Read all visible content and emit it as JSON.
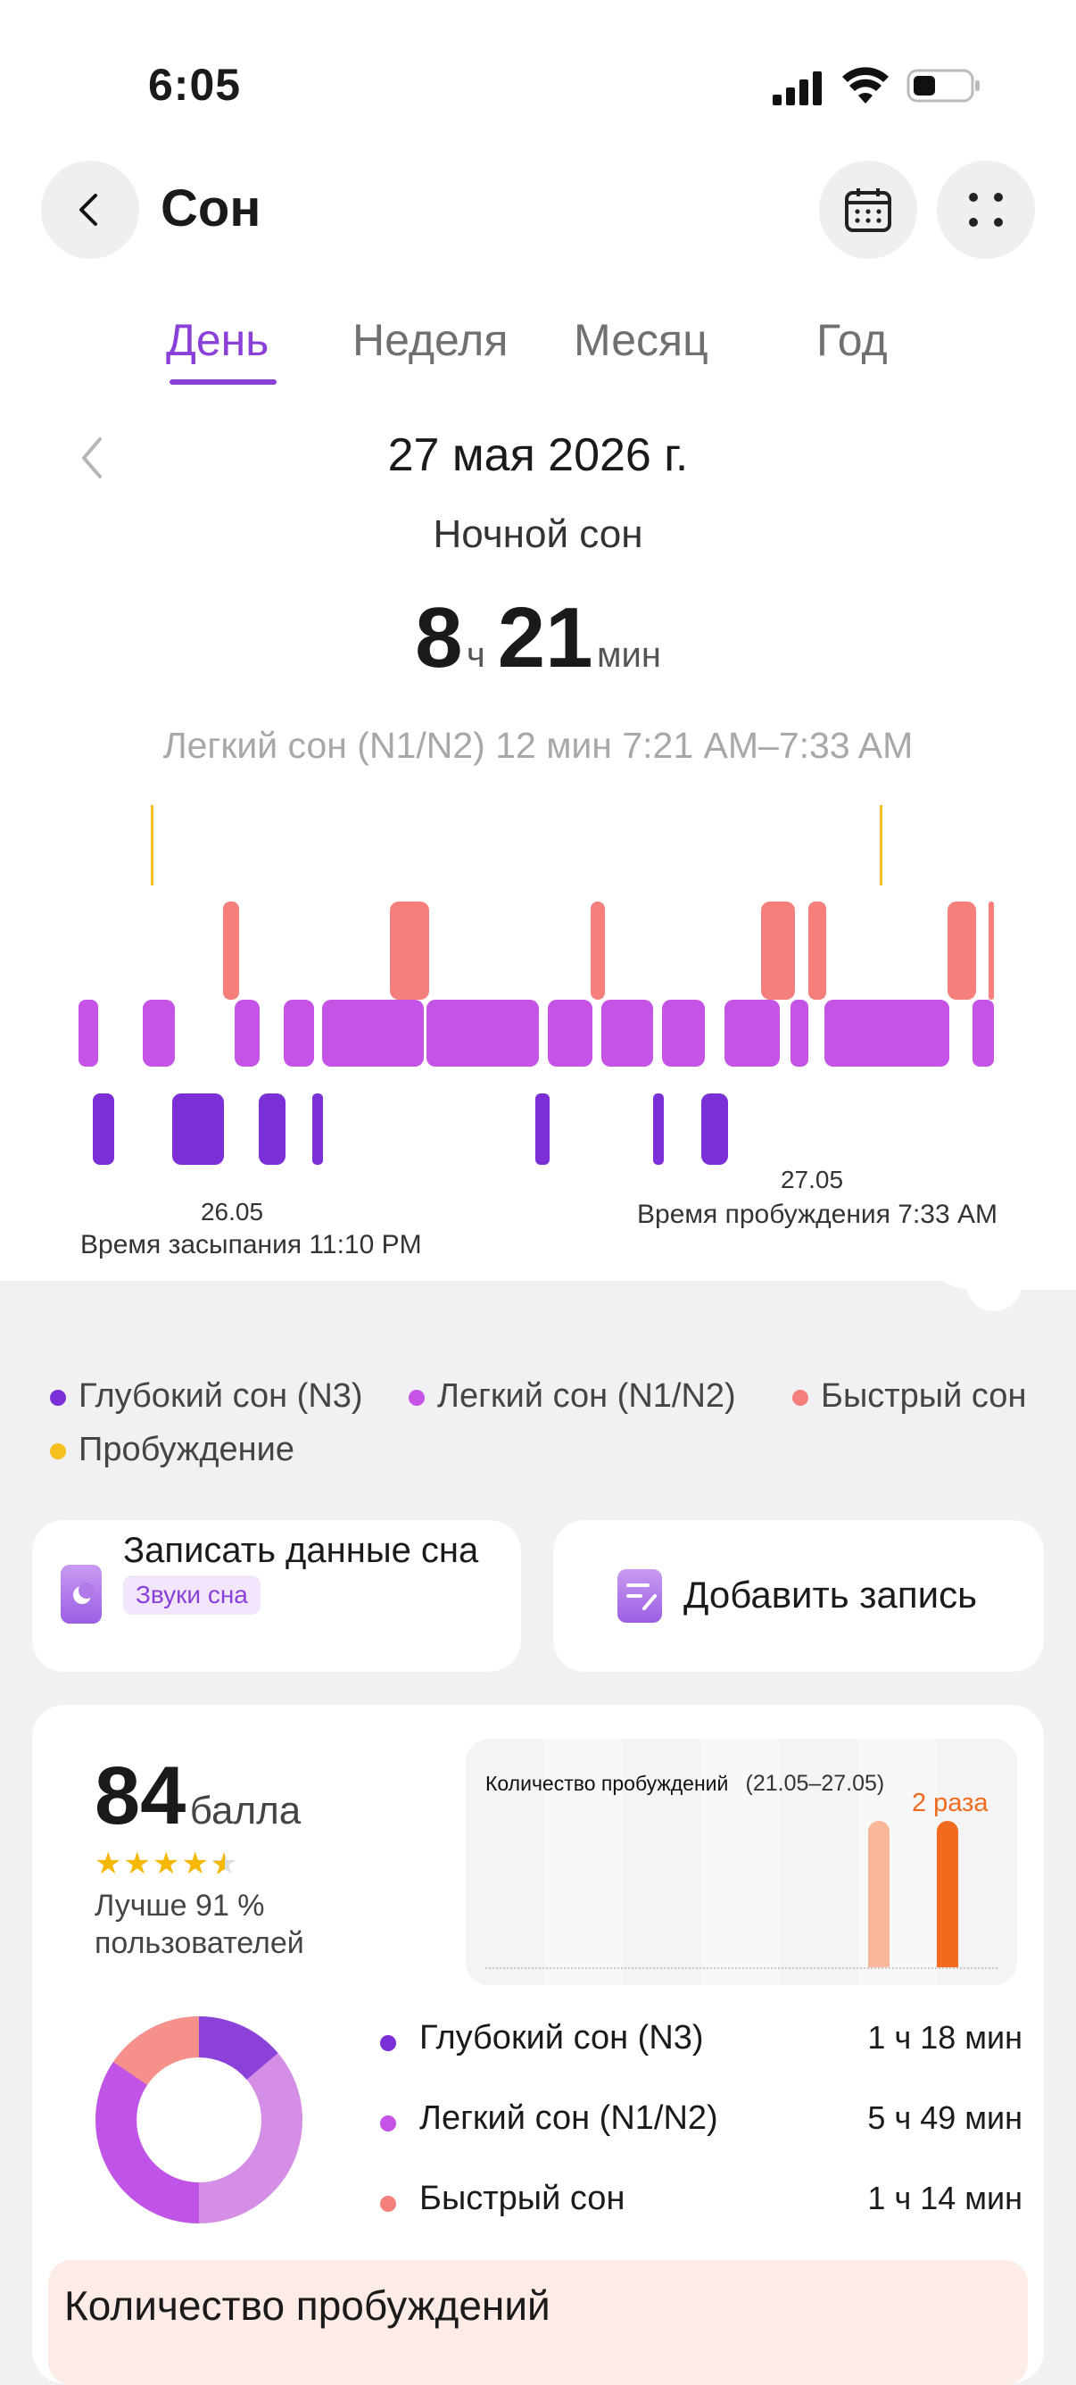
{
  "status_bar": {
    "time": "6:05"
  },
  "header": {
    "title": "Сон"
  },
  "tabs": [
    {
      "label": "День",
      "active": true
    },
    {
      "label": "Неделя",
      "active": false
    },
    {
      "label": "Месяц",
      "active": false
    },
    {
      "label": "Год",
      "active": false
    }
  ],
  "summary": {
    "date": "27 мая 2026 г.",
    "sleep_type": "Ночной сон",
    "hours": "8",
    "hours_unit": "ч",
    "minutes": "21",
    "minutes_unit": "мин",
    "selected_segment": "Легкий сон (N1/N2) 12 мин 7:21 AM–7:33 AM"
  },
  "hypnogram": {
    "start_date": "26.05",
    "start_label": "Время засыпания 11:10 PM",
    "end_date": "27.05",
    "end_label": "Время пробуждения 7:33 AM"
  },
  "legend": [
    {
      "label": "Глубокий сон (N3)",
      "color": "#7b2fd6"
    },
    {
      "label": "Легкий сон (N1/N2)",
      "color": "#c554e6"
    },
    {
      "label": "Быстрый сон",
      "color": "#f57f7a"
    },
    {
      "label": "Пробуждение",
      "color": "#f5c020"
    }
  ],
  "actions": {
    "record": {
      "title": "Записать данные сна",
      "chip": "Звуки сна"
    },
    "add": {
      "title": "Добавить запись"
    }
  },
  "score": {
    "value": "84",
    "unit": "балла",
    "stars": 4.5,
    "better_than": "Лучше 91 %",
    "better_than_suffix": "пользователей"
  },
  "wake_chart": {
    "title": "Количество пробуждений",
    "range": "(21.05–27.05)",
    "value_label": "2 раза"
  },
  "stages": [
    {
      "label": "Глубокий сон (N3)",
      "duration": "1 ч 18 мин",
      "color": "#7b2fd6",
      "minutes": 78
    },
    {
      "label": "Легкий сон (N1/N2)",
      "duration": "5 ч 49 мин",
      "color": "#c554e6",
      "minutes": 349
    },
    {
      "label": "Быстрый сон",
      "duration": "1 ч 14 мин",
      "color": "#f57f7a",
      "minutes": 74
    }
  ],
  "bottom_section": {
    "title": "Количество пробуждений"
  }
}
